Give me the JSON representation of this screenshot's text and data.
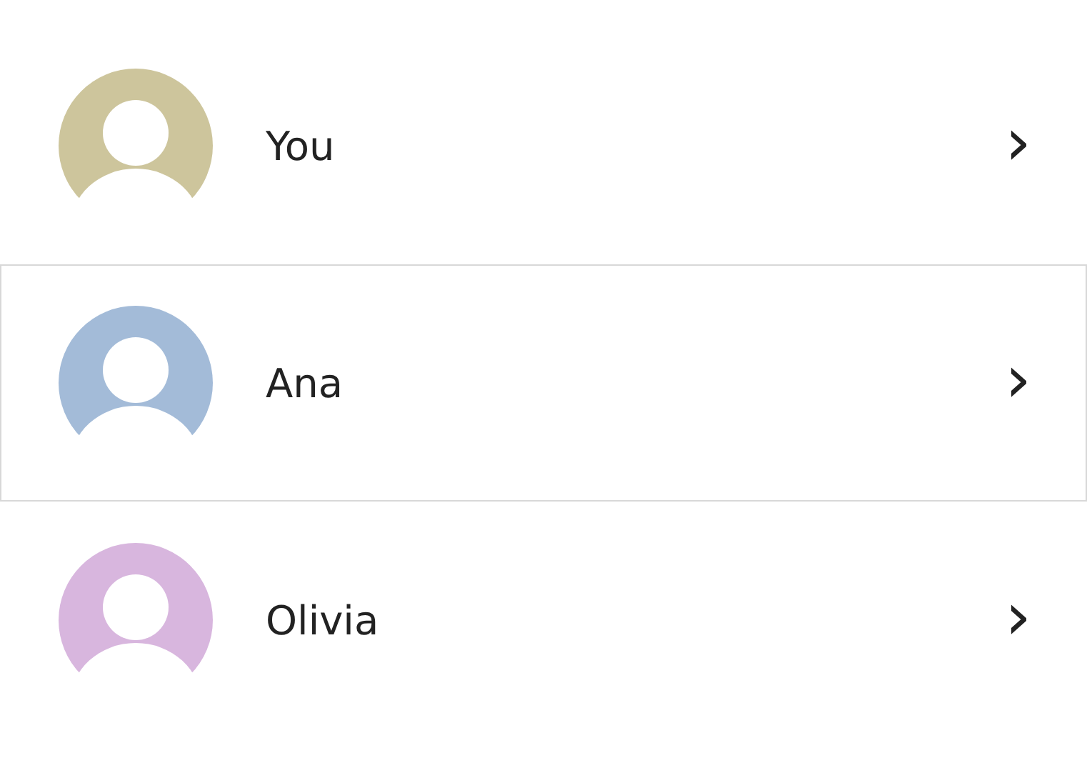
{
  "contacts": [
    {
      "name": "You",
      "color": "#cdc59c",
      "selected": false,
      "chevron": "›"
    },
    {
      "name": "Ana",
      "color": "#a3bbd8",
      "selected": true,
      "chevron": "›"
    },
    {
      "name": "Olivia",
      "color": "#d8b6de",
      "selected": false,
      "chevron": "›"
    }
  ]
}
